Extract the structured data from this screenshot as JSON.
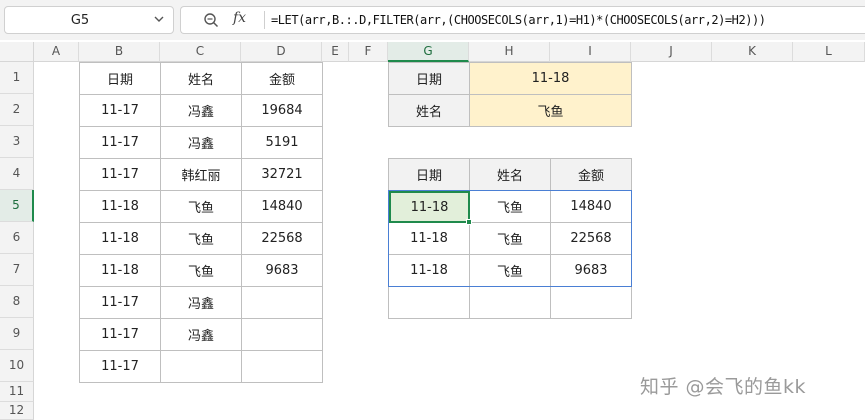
{
  "formula_bar": {
    "name_box": "G5",
    "fx_label": "fx",
    "formula": "=LET(arr,B.:.D,FILTER(arr,(CHOOSECOLS(arr,1)=H1)*(CHOOSECOLS(arr,2)=H2)))"
  },
  "columns": [
    "A",
    "B",
    "C",
    "D",
    "E",
    "F",
    "G",
    "H",
    "I",
    "J",
    "K",
    "L"
  ],
  "rows": [
    "1",
    "2",
    "3",
    "4",
    "5",
    "6",
    "7",
    "8",
    "9",
    "10",
    "11",
    "12"
  ],
  "selected": {
    "column": "G",
    "row": "5"
  },
  "source_table": {
    "headers": [
      "日期",
      "姓名",
      "金额"
    ],
    "rows": [
      [
        "11-17",
        "冯鑫",
        "19684"
      ],
      [
        "11-17",
        "冯鑫",
        "5191"
      ],
      [
        "11-17",
        "韩红丽",
        "32721"
      ],
      [
        "11-18",
        "飞鱼",
        "14840"
      ],
      [
        "11-18",
        "飞鱼",
        "22568"
      ],
      [
        "11-18",
        "飞鱼",
        "9683"
      ],
      [
        "11-17",
        "冯鑫",
        ""
      ],
      [
        "11-17",
        "冯鑫",
        ""
      ],
      [
        "11-17",
        "",
        ""
      ]
    ]
  },
  "criteria": {
    "rows": [
      {
        "label": "日期",
        "value": "11-18"
      },
      {
        "label": "姓名",
        "value": "飞鱼"
      }
    ]
  },
  "result_table": {
    "headers": [
      "日期",
      "姓名",
      "金额"
    ],
    "rows": [
      [
        "11-18",
        "飞鱼",
        "14840"
      ],
      [
        "11-18",
        "飞鱼",
        "22568"
      ],
      [
        "11-18",
        "飞鱼",
        "9683"
      ],
      [
        "",
        "",
        ""
      ]
    ]
  },
  "watermark": "知乎 @会飞的鱼kk",
  "colors": {
    "accent_green": "#1f8a4c",
    "header_gray": "#f2f2f2",
    "criteria_yellow": "#fff2cc",
    "spill_blue": "#4a7fd4"
  }
}
